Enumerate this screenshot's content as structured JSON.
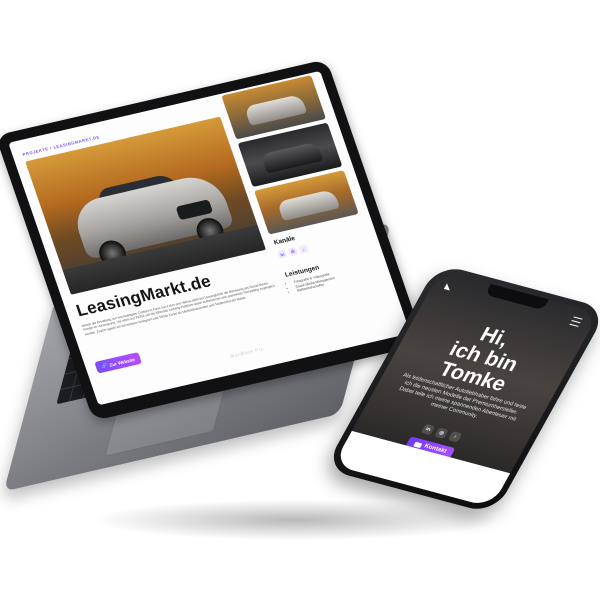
{
  "laptop": {
    "brand_label": "MacBook Pro",
    "site": {
      "breadcrumb": "PROJEKTE / LEASINGMARKT.DE",
      "title": "LeasingMarkt.de",
      "description": "Neben der Erstellung von hochwertigem Content in Form von Fotos und Videos steht bei LeasingMarkt die Betreuung der Social-Media-Kanäle im Vordergrund. Vor allem auf TikTok soll die führende Leasing-Plattform durch authentische und spannende Storytelling zugänglich werden. Zudem agiere ich mit meinem Instagram und TikTok Kanal als Markenbotschafter und Testimonial der Marke.",
      "website_button": "Zur Website",
      "channels_heading": "Kanäle",
      "channels": [
        {
          "label": "in",
          "icon": "linkedin-icon"
        },
        {
          "label": "◎",
          "icon": "instagram-icon"
        },
        {
          "label": "♪",
          "icon": "tiktok-icon"
        }
      ],
      "services_heading": "Leistungen",
      "services": [
        "Fotografie & Videografie",
        "Social Media Management",
        "Markenbotschafter"
      ]
    }
  },
  "phone": {
    "greeting": [
      "Hi,",
      "ich bin",
      "Tomke"
    ],
    "bio": "Als leidenschaftlicher Autoliebhaber fahre und teste ich die neusten Modelle der Premiumhersteller. Dabei teile ich meine spannenden Abenteuer mit meiner Community.",
    "channels": [
      {
        "label": "in",
        "icon": "linkedin-icon"
      },
      {
        "label": "◎",
        "icon": "instagram-icon"
      },
      {
        "label": "♪",
        "icon": "tiktok-icon"
      }
    ],
    "contact_button": "Kontakt"
  },
  "colors": {
    "accent": "#7b4dff",
    "accent_secondary": "#b44dff"
  }
}
